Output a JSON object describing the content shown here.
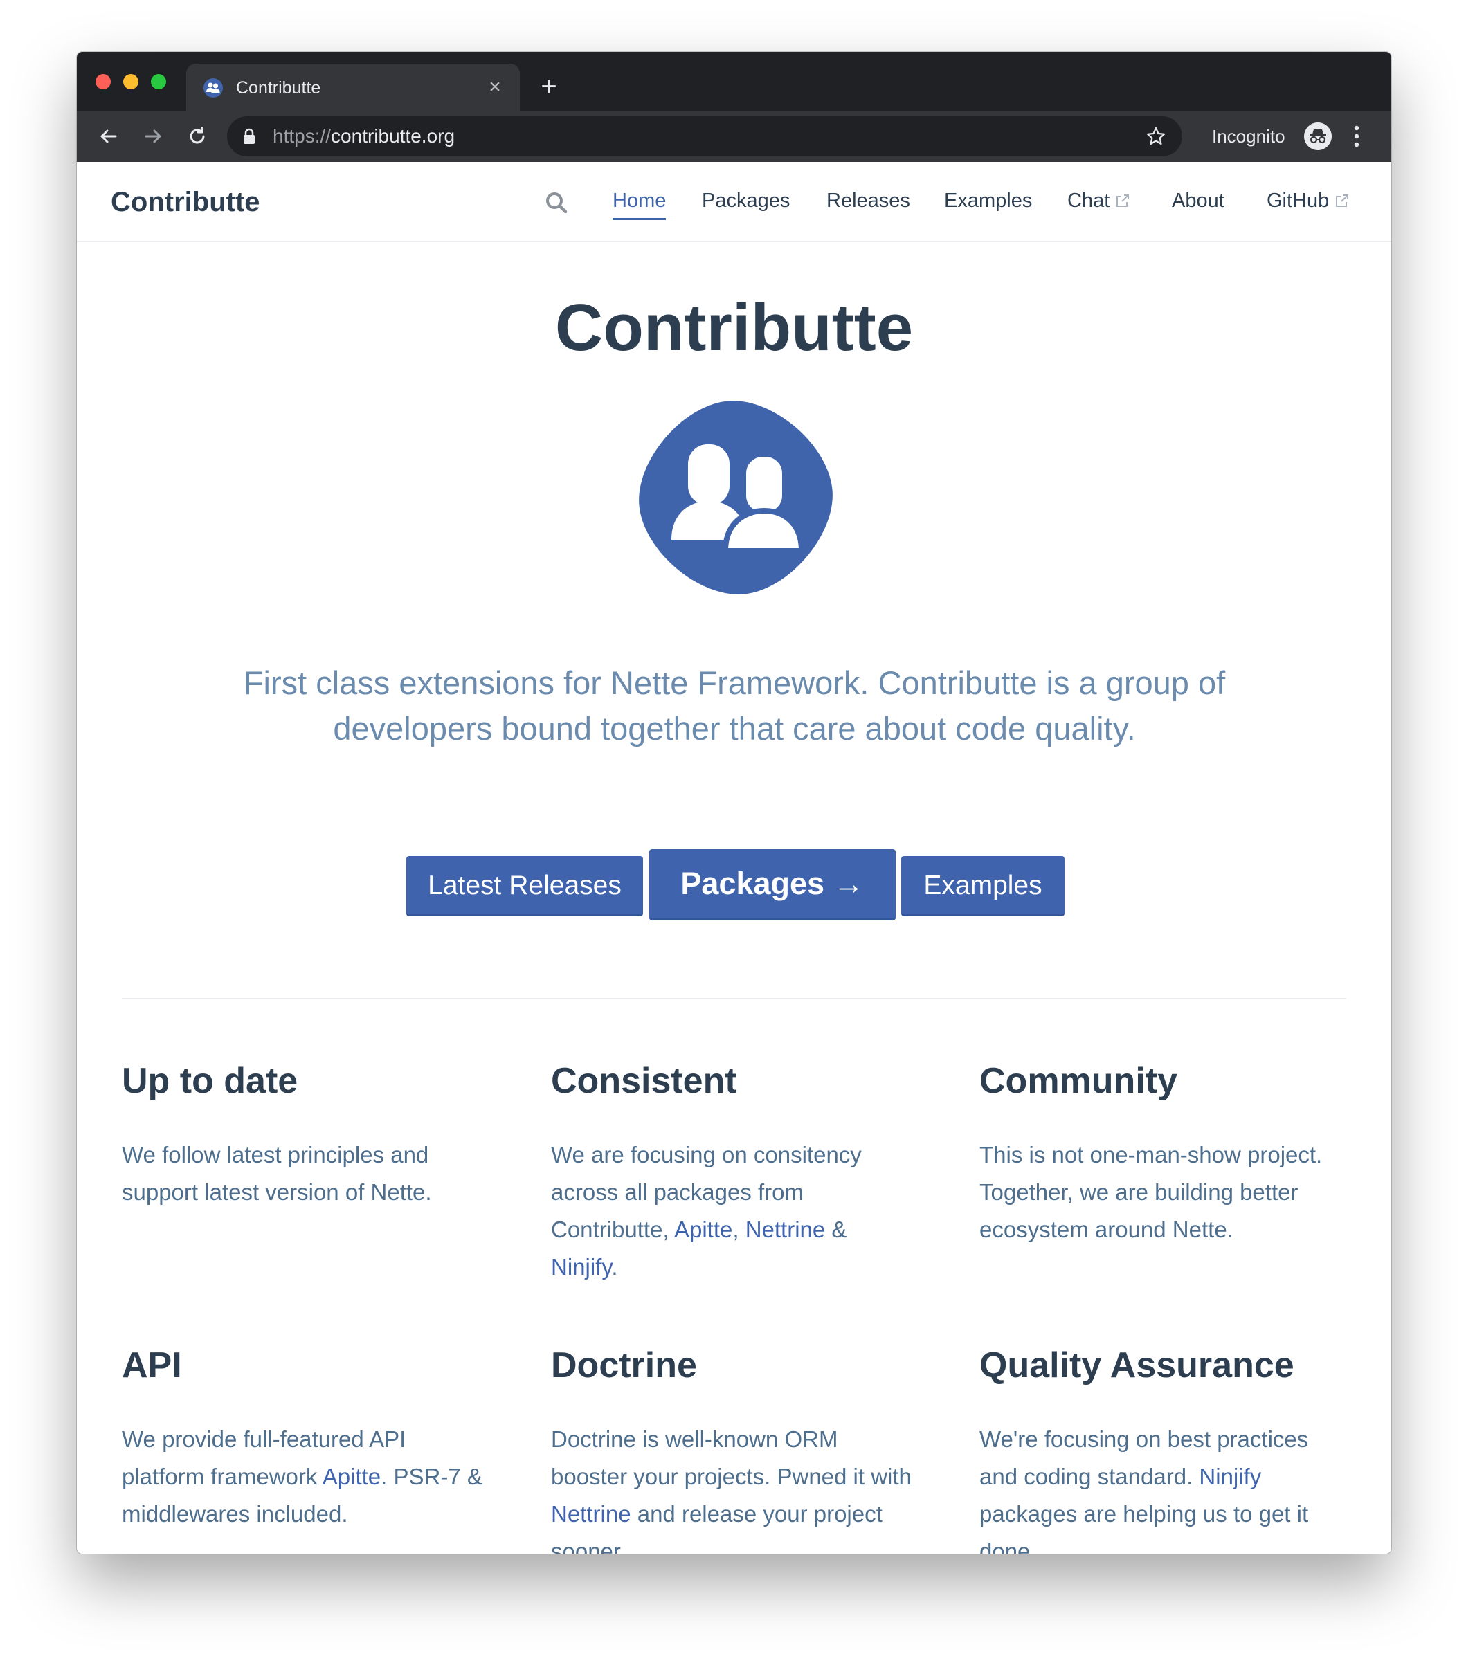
{
  "browser": {
    "tab_title": "Contributte",
    "url_scheme": "https://",
    "url_host": "contributte.org",
    "incognito_label": "Incognito"
  },
  "nav": {
    "brand": "Contributte",
    "items": [
      {
        "label": "Home",
        "active": true
      },
      {
        "label": "Packages"
      },
      {
        "label": "Releases"
      },
      {
        "label": "Examples"
      },
      {
        "label": "Chat",
        "external": true
      },
      {
        "label": "About"
      },
      {
        "label": "GitHub",
        "external": true
      }
    ]
  },
  "hero": {
    "title": "Contributte",
    "description": "First class extensions for Nette Framework. Contributte is a group of developers bound together that care about code quality.",
    "buttons": {
      "latest_releases": "Latest Releases",
      "packages": "Packages →",
      "examples": "Examples"
    }
  },
  "features": [
    {
      "title": "Up to date",
      "text": [
        "We follow latest principles and support latest version of Nette."
      ]
    },
    {
      "title": "Consistent",
      "text": [
        "We are focusing on consitency across all packages from Contributte, ",
        "Apitte",
        ", ",
        "Nettrine",
        " & ",
        "Ninjify",
        "."
      ]
    },
    {
      "title": "Community",
      "text": [
        "This is not one-man-show project. Together, we are building better ecosystem around Nette."
      ]
    },
    {
      "title": "API",
      "text": [
        "We provide full-featured API platform framework ",
        "Apitte",
        ". PSR-7 & middlewares included."
      ]
    },
    {
      "title": "Doctrine",
      "text": [
        "Doctrine is well-known ORM booster your projects. Pwned it with ",
        "Nettrine",
        " and release your project sooner."
      ]
    },
    {
      "title": "Quality Assurance",
      "text": [
        "We're focusing on best practices and coding standard. ",
        "Ninjify",
        " packages are helping us to get it done."
      ]
    }
  ],
  "colors": {
    "brand": "#3f64ad",
    "heading": "#2c3e50",
    "muted": "#6a8bad"
  }
}
